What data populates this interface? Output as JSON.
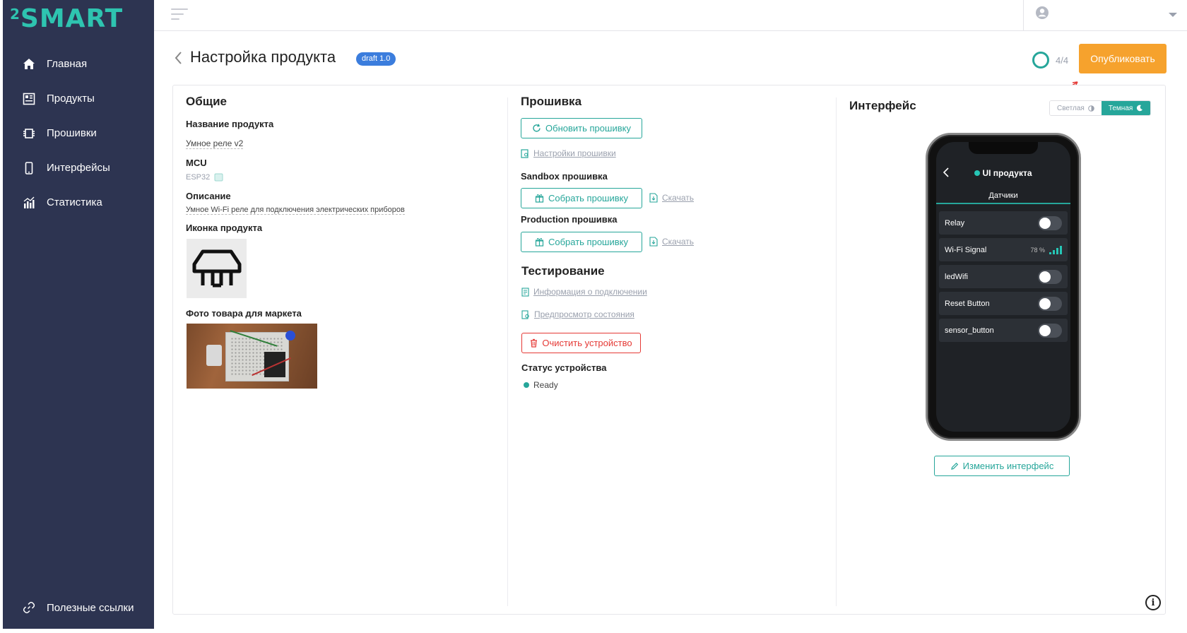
{
  "app": {
    "logo_sup": "2",
    "logo_text": "SMART"
  },
  "sidebar": {
    "items": [
      {
        "label": "Главная",
        "icon": "home-icon"
      },
      {
        "label": "Продукты",
        "icon": "products-icon"
      },
      {
        "label": "Прошивки",
        "icon": "chip-icon"
      },
      {
        "label": "Интерфейсы",
        "icon": "phone-icon"
      },
      {
        "label": "Статистика",
        "icon": "stats-icon"
      }
    ],
    "useful_links": "Полезные ссылки"
  },
  "header": {
    "title": "Настройка продукта",
    "badge": "draft 1.0",
    "progress": "4/4",
    "publish": "Опубликовать"
  },
  "general": {
    "heading": "Общие",
    "name_label": "Название продукта",
    "name_value": "Умное реле v2",
    "mcu_label": "MCU",
    "mcu_value": "ESP32",
    "desc_label": "Описание",
    "desc_value": "Умное Wi-Fi реле для подключения электрических приборов",
    "icon_label": "Иконка продукта",
    "photo_label": "Фото товара для маркета"
  },
  "firmware": {
    "heading": "Прошивка",
    "update_btn": "Обновить прошивку",
    "settings_link": "Настройки прошивки",
    "sandbox_label": "Sandbox прошивка",
    "build_btn": "Собрать прошивку",
    "download": "Скачать",
    "production_label": "Production прошивка",
    "testing_heading": "Тестирование",
    "conn_info": "Информация о подключении",
    "preview_state": "Предпросмотр состояния",
    "clear_device": "Очистить устройство",
    "status_label": "Статус устройства",
    "status_value": "Ready"
  },
  "interface": {
    "heading": "Интерфейс",
    "theme_light": "Светлая",
    "theme_dark": "Темная",
    "phone_title": "UI продукта",
    "phone_tab": "Датчики",
    "rows": [
      {
        "label": "Relay",
        "type": "switch"
      },
      {
        "label": "Wi-Fi Signal",
        "type": "signal",
        "value": "78 %"
      },
      {
        "label": "ledWifi",
        "type": "switch"
      },
      {
        "label": "Reset Button",
        "type": "switch"
      },
      {
        "label": "sensor_button",
        "type": "switch"
      }
    ],
    "edit_btn": "Изменить интерфейс"
  },
  "colors": {
    "sidebar": "#2d3451",
    "accent": "#26a69a",
    "publish": "#f6a22d",
    "badge": "#3b7ddd",
    "danger": "#e53935"
  }
}
